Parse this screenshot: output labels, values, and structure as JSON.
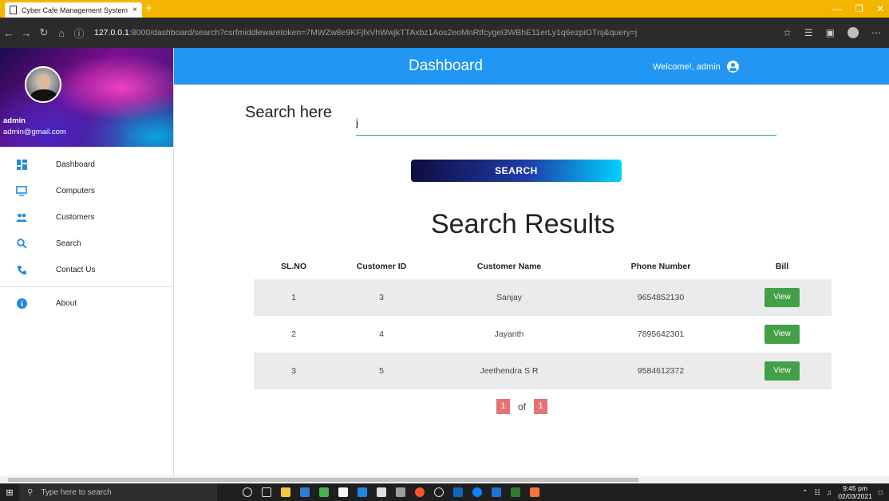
{
  "browser": {
    "tab_title": "Cyber Cafe Management System",
    "tab_close": "×",
    "new_tab": "+",
    "url_host": "127.0.0.1",
    "url_rest": ":8000/dashboard/search?csrfmiddlewaretoken=7MWZw8e9KFjfxVhWwjkTTAxbz1Aos2eoMnRtfcygei3WBhE11erLy1q6ezpiOTnj&query=j",
    "colors": {
      "tab_strip": "#f4b400",
      "toolbar": "#2b2b2b"
    }
  },
  "sidebar": {
    "user_name": "admin",
    "user_email": "admin@gmail.com",
    "items": [
      {
        "label": "Dashboard",
        "icon": "dashboard-icon"
      },
      {
        "label": "Computers",
        "icon": "computer-icon"
      },
      {
        "label": "Customers",
        "icon": "people-icon"
      },
      {
        "label": "Search",
        "icon": "search-icon"
      },
      {
        "label": "Contact Us",
        "icon": "phone-icon"
      },
      {
        "label": "About",
        "icon": "info-icon"
      }
    ]
  },
  "header": {
    "title": "Dashboard",
    "welcome": "Welcome!, admin",
    "color": "#2196f3"
  },
  "search": {
    "label": "Search here",
    "value": "j",
    "placeholder": "",
    "button_label": "SEARCH"
  },
  "results": {
    "title": "Search Results",
    "columns": [
      "SL.NO",
      "Customer ID",
      "Customer Name",
      "Phone Number",
      "Bill"
    ],
    "rows": [
      {
        "sl": "1",
        "customer_id": "3",
        "name": "Sanjay",
        "phone": "9654852130",
        "bill": "View"
      },
      {
        "sl": "2",
        "customer_id": "4",
        "name": "Jayanth",
        "phone": "7895642301",
        "bill": "View"
      },
      {
        "sl": "3",
        "customer_id": "5",
        "name": "Jeethendra S R",
        "phone": "9584612372",
        "bill": "View"
      }
    ]
  },
  "pagination": {
    "current": "1",
    "of": "of",
    "total": "1"
  },
  "taskbar": {
    "search_placeholder": "Type here to search",
    "time": "9:45 pm",
    "date": "02/03/2021"
  }
}
